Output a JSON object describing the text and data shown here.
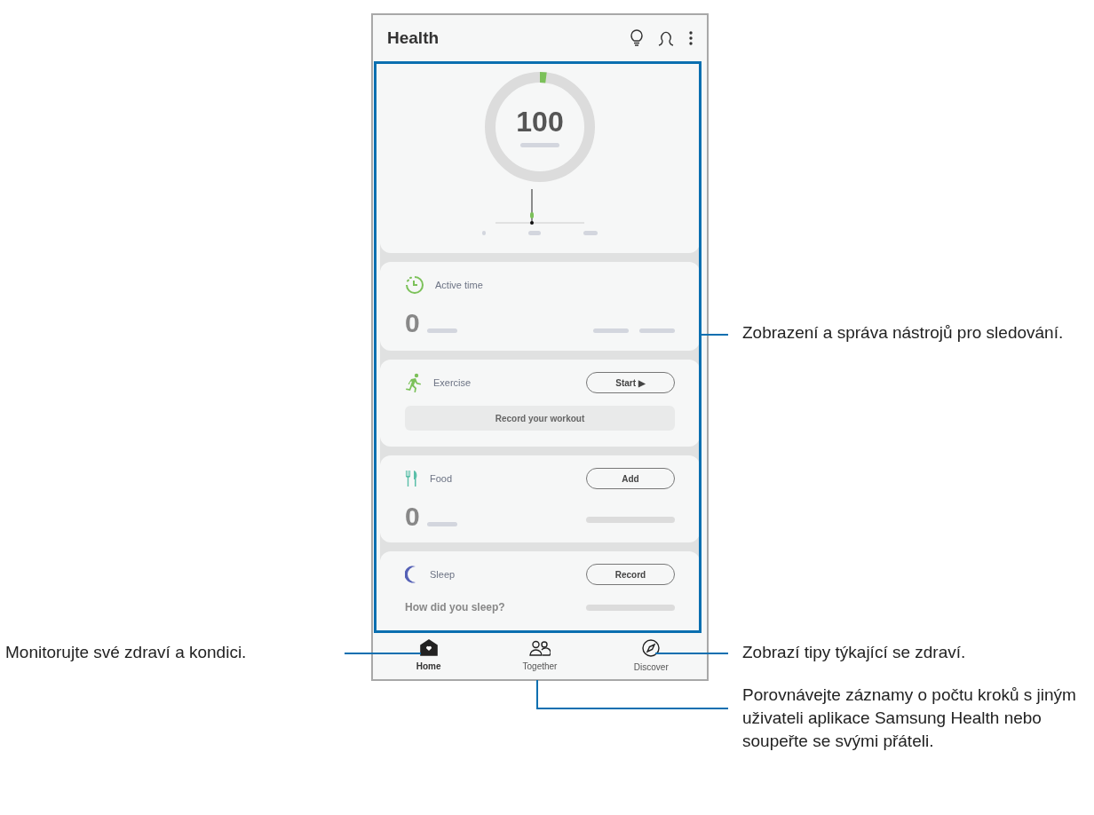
{
  "app": {
    "title": "Health",
    "steps": {
      "count": "100",
      "level": 0.02
    },
    "cards": [
      {
        "kind": "active",
        "title": "Active time",
        "value": "0"
      },
      {
        "kind": "exercise",
        "title": "Exercise",
        "button": "Start ▶",
        "wide_button": "Record your workout"
      },
      {
        "kind": "food",
        "title": "Food",
        "button": "Add",
        "value": "0",
        "level": 0
      },
      {
        "kind": "sleep",
        "title": "Sleep",
        "button": "Record",
        "question": "How did you sleep?",
        "level": 0
      }
    ],
    "nav": [
      {
        "label": "Home",
        "selected": true
      },
      {
        "label": "Together",
        "selected": false
      },
      {
        "label": "Discover",
        "selected": false
      }
    ]
  },
  "callouts": [
    {
      "kind": "cards",
      "text": "Zobrazení a správa nástrojů pro sledování."
    },
    {
      "kind": "home",
      "text": "Monitorujte své zdraví a kondici."
    },
    {
      "kind": "discover",
      "text": "Zobrazí tipy týkající se zdraví."
    },
    {
      "kind": "together",
      "text": "Porovnávejte záznamy o počtu kroků s jiným uživateli aplikace Samsung Health nebo soupeřte se svými přáteli."
    }
  ]
}
